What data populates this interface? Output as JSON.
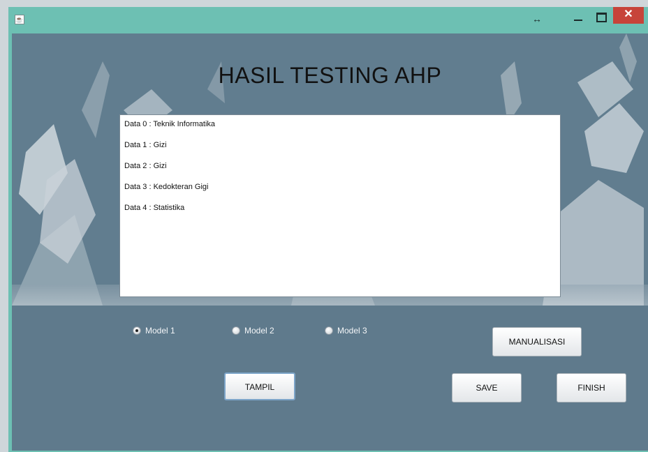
{
  "window": {
    "icon": "java-app-icon",
    "controls": {
      "resize": "↔",
      "close": "✕"
    }
  },
  "main": {
    "title": "HASIL TESTING AHP",
    "results": [
      "Data 0 : Teknik Informatika",
      "Data 1 : Gizi",
      "Data 2 : Gizi",
      "Data 3 : Kedokteran Gigi",
      "Data 4 : Statistika"
    ],
    "models": [
      {
        "label": "Model 1",
        "selected": true
      },
      {
        "label": "Model 2",
        "selected": false
      },
      {
        "label": "Model 3",
        "selected": false
      }
    ],
    "buttons": {
      "tampil": "TAMPIL",
      "manualisasi": "MANUALISASI",
      "save": "SAVE",
      "finish": "FINISH"
    }
  },
  "colors": {
    "titlebar": "#6dc0b3",
    "background": "#5f7a8c",
    "close": "#c7443a"
  }
}
